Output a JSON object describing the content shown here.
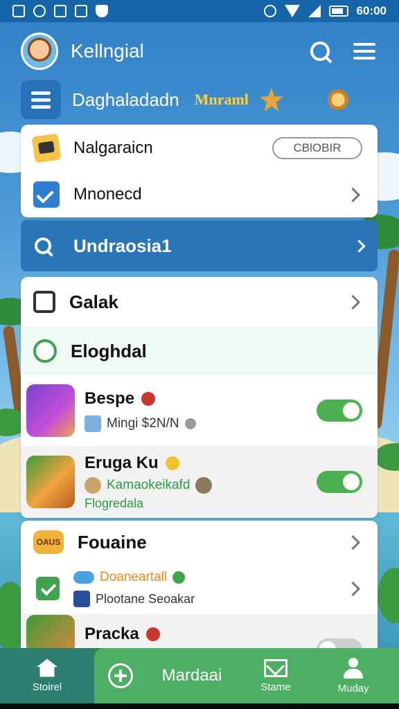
{
  "status_bar": {
    "time": "60:00"
  },
  "header": {
    "title": "Kellngial"
  },
  "subheader": {
    "title": "Daghaladadn",
    "badge": "Mnraml"
  },
  "card1": {
    "items": [
      {
        "label": "Nalgaraicn",
        "pill": "CBlOBIR"
      },
      {
        "label": "Mnonecd"
      }
    ]
  },
  "search_strip": {
    "label": "Undraosia1"
  },
  "card2": {
    "galak": "Galak",
    "eloghdal": "Eloghdal",
    "games": [
      {
        "title": "Bespe",
        "sub": "Mingi $2N/N",
        "toggle_on": true
      },
      {
        "title": "Eruga Ku",
        "sub": "Kamaokeikafd",
        "sub2": "Flogredala",
        "toggle_on": true
      }
    ]
  },
  "card3": {
    "title": "Fouaine",
    "thumb_text": "OAUS",
    "line1": "Doaneartall",
    "line2": "Plootane Seoakar",
    "game": {
      "title": "Pracka",
      "toggle_on": false
    }
  },
  "bottom_nav": {
    "home": "Stoirel",
    "main": "Mardaai",
    "stame": "Stame",
    "profile": "Muday"
  },
  "colors": {
    "primary_blue": "#2a74b8",
    "toggle_green": "#4caf50",
    "nav_green": "#4daf63",
    "gold": "#ffd23f"
  }
}
